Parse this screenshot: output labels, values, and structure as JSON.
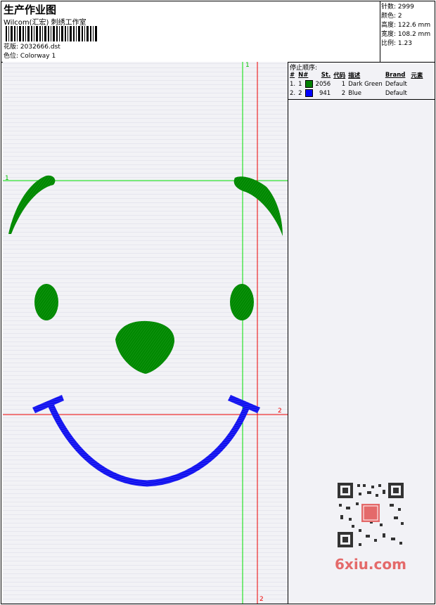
{
  "header": {
    "title": "生产作业图",
    "subtitle": "Wilcom(汇宏) 刺绣工作室",
    "design_label": "花版:",
    "design_value": "2032666.dst",
    "colorway_label": "色位:",
    "colorway_value": "Colorway 1"
  },
  "specs": [
    {
      "label": "针数:",
      "value": "2999"
    },
    {
      "label": "颜色:",
      "value": "2"
    },
    {
      "label": "高度:",
      "value": "122.6 mm"
    },
    {
      "label": "宽度:",
      "value": "108.2 mm"
    },
    {
      "label": "比例:",
      "value": "1.23"
    }
  ],
  "stop_panel": {
    "heading": "停止顺序:",
    "columns": [
      "#",
      "N#",
      "St.",
      "代码",
      "描述",
      "Brand",
      "元素"
    ],
    "rows": [
      {
        "num": "1.",
        "n": "1",
        "color": "#008000",
        "st": "2056",
        "code": "1",
        "desc": "Dark Green",
        "brand": "Default"
      },
      {
        "num": "2.",
        "n": "2",
        "color": "#0000ff",
        "st": "941",
        "code": "2",
        "desc": "Blue",
        "brand": "Default"
      }
    ]
  },
  "guides": {
    "green_top": "1",
    "green_left": "1",
    "red_right": "2",
    "red_bottom": "2"
  },
  "colors": {
    "green": "#008800",
    "blue": "#1010ee",
    "guide_green": "#00e000",
    "guide_red": "#ee0000"
  },
  "watermark": "6xiu.com"
}
